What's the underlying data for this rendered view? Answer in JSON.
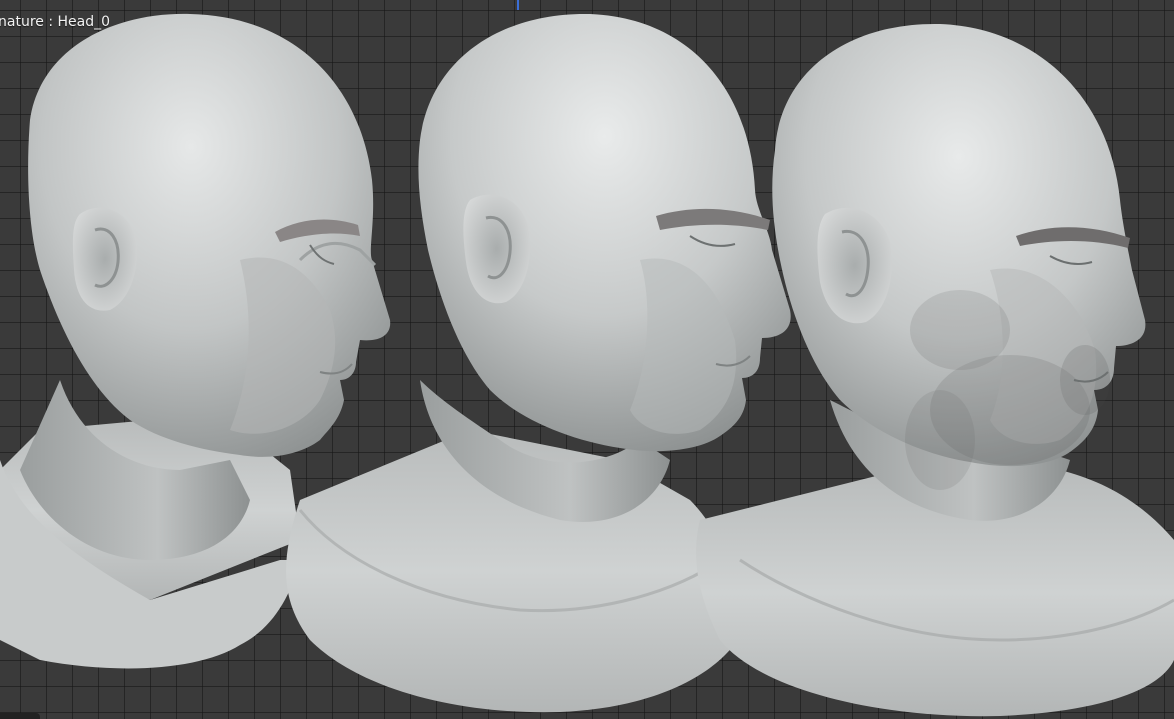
{
  "viewport": {
    "object_label": "nature : Head_0",
    "axis_marker_color": "#3b6fd8",
    "grid_color": "#2a2a2a",
    "background_color": "#3a3a3a",
    "mesh_color": "#c6c8c8"
  }
}
